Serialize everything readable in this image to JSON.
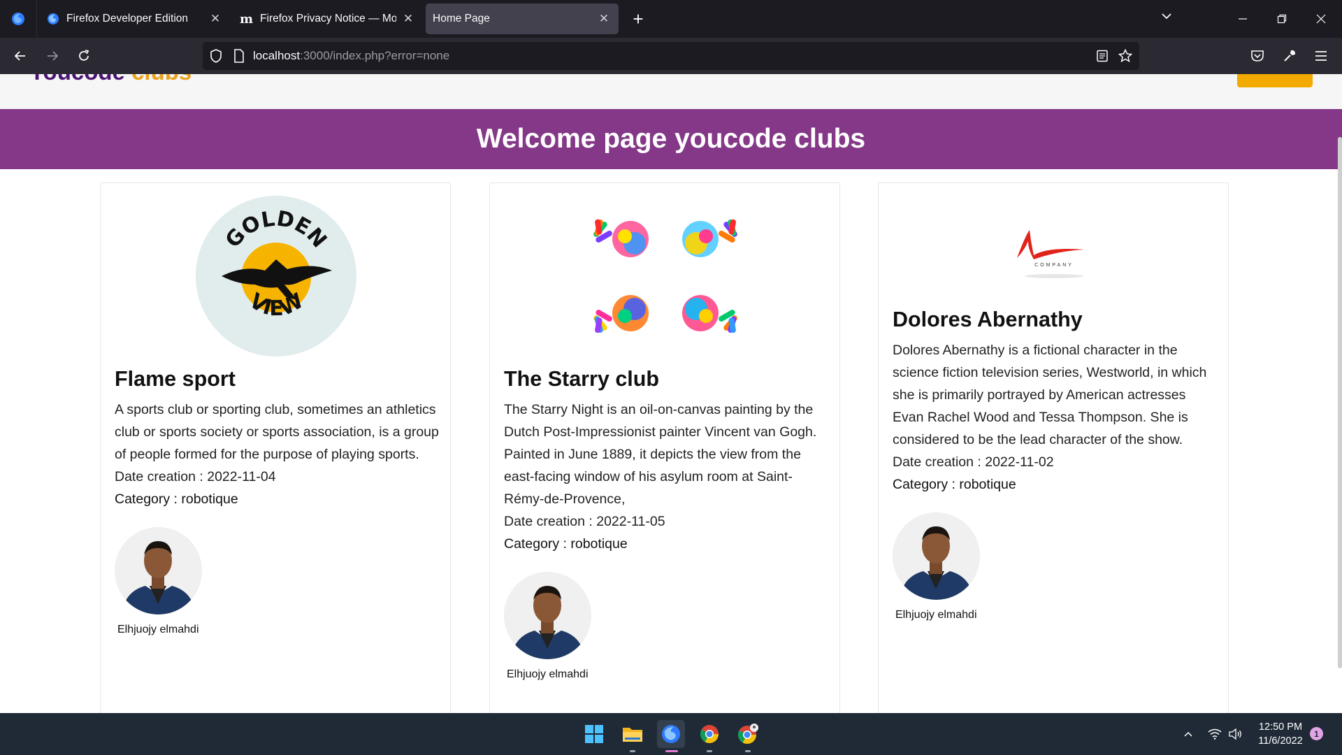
{
  "browser": {
    "tabs": [
      {
        "title": "Firefox Developer Edition",
        "icon": "firefox-icon"
      },
      {
        "title": "Firefox Privacy Notice — Mozilla",
        "icon": "mozilla-m-icon"
      },
      {
        "title": "Home Page",
        "icon": "none",
        "active": true
      }
    ],
    "new_tab": "+",
    "url_host": "localhost",
    "url_rest": ":3000/index.php?error=none"
  },
  "site": {
    "logo_main": "Youcode",
    "logo_accent": "clubs",
    "banner_title": "Welcome page youcode clubs"
  },
  "clubs": [
    {
      "name": "Flame sport",
      "logo": "golden-view-eagle-logo",
      "logo_text_top": "GOLDEN",
      "logo_text_bottom": "VIEW",
      "description": "A sports club or sporting club, sometimes an athletics club or sports society or sports association, is a group of people formed for the purpose of playing sports.",
      "date_creation": "Date creation : 2022-11-04",
      "category": "Category : robotique",
      "owner": "Elhjuojy elmahdi"
    },
    {
      "name": "The Starry club",
      "logo": "colorful-handprints-logo",
      "description": "The Starry Night is an oil-on-canvas painting by the Dutch Post-Impressionist painter Vincent van Gogh. Painted in June 1889, it depicts the view from the east-facing window of his asylum room at Saint-Rémy-de-Provence,",
      "date_creation": "Date creation : 2022-11-05",
      "category": "Category : robotique",
      "owner": "Elhjuojy elmahdi"
    },
    {
      "name": "Dolores Abernathy",
      "logo": "company-swoosh-logo",
      "logo_text": "COMPANY",
      "description": "Dolores Abernathy is a fictional character in the science fiction television series, Westworld, in which she is primarily portrayed by American actresses Evan Rachel Wood and Tessa Thompson. She is considered to be the lead character of the show.",
      "date_creation": "Date creation : 2022-11-02",
      "category": "Category : robotique",
      "owner": "Elhjuojy elmahdi"
    }
  ],
  "taskbar": {
    "time": "12:50 PM",
    "date": "11/6/2022",
    "notifications": "1"
  },
  "colors": {
    "banner": "#843887",
    "accent": "#f2a900",
    "tab_bg": "#1c1b22",
    "taskbar": "#1f2a36"
  }
}
